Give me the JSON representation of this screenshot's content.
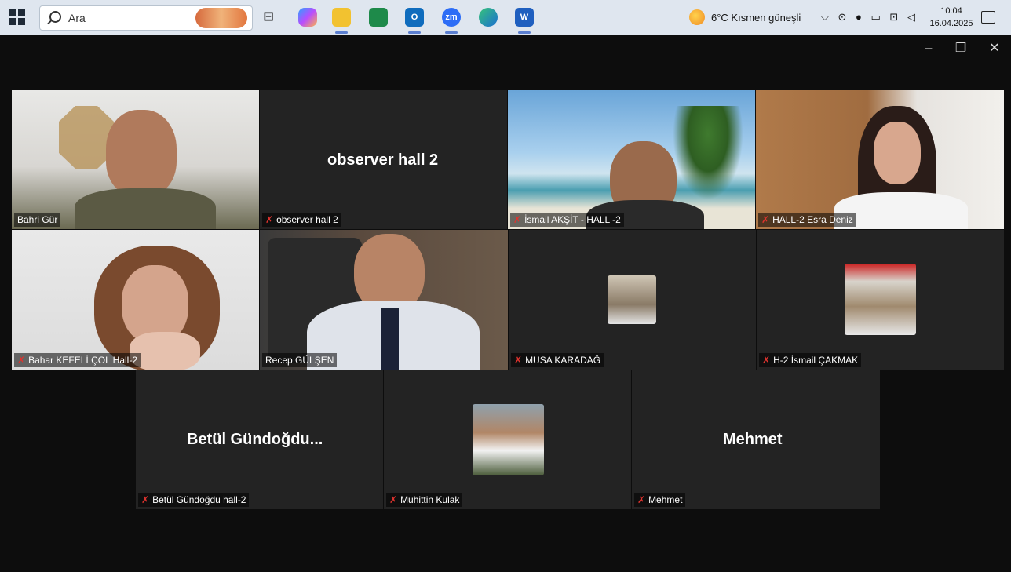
{
  "taskbar": {
    "search_placeholder": "Ara",
    "weather_text": "6°C  Kısmen güneşli",
    "time": "10:04",
    "date": "16.04.2025",
    "zoom_app_label": "zm",
    "word_app_label": "W",
    "outlook_app_label": "O"
  },
  "participants": [
    {
      "name": "Bahri Gür",
      "muted": false
    },
    {
      "name": "observer hall 2",
      "big_label": "observer hall 2",
      "muted": true
    },
    {
      "name": "İsmail AKŞİT - HALL -2",
      "muted": true
    },
    {
      "name": "HALL-2 Esra Deniz",
      "muted": true
    },
    {
      "name": "Bahar KEFELİ ÇOL Hall-2",
      "muted": true
    },
    {
      "name": "Recep GÜLŞEN",
      "muted": false,
      "active_speaker": true
    },
    {
      "name": "MUSA KARADAĞ",
      "muted": true
    },
    {
      "name": "H-2  İsmail ÇAKMAK",
      "muted": true
    },
    {
      "name": "Betül Gündoğdu hall-2",
      "big_label": "Betül  Gündoğdu...",
      "muted": true
    },
    {
      "name": "Muhittin Kulak",
      "muted": true
    },
    {
      "name": "Mehmet",
      "big_label": "Mehmet",
      "muted": true
    }
  ],
  "colors": {
    "active_speaker_border": "#2ed573",
    "muted_icon": "#e0332e",
    "tile_bg": "#232323"
  }
}
